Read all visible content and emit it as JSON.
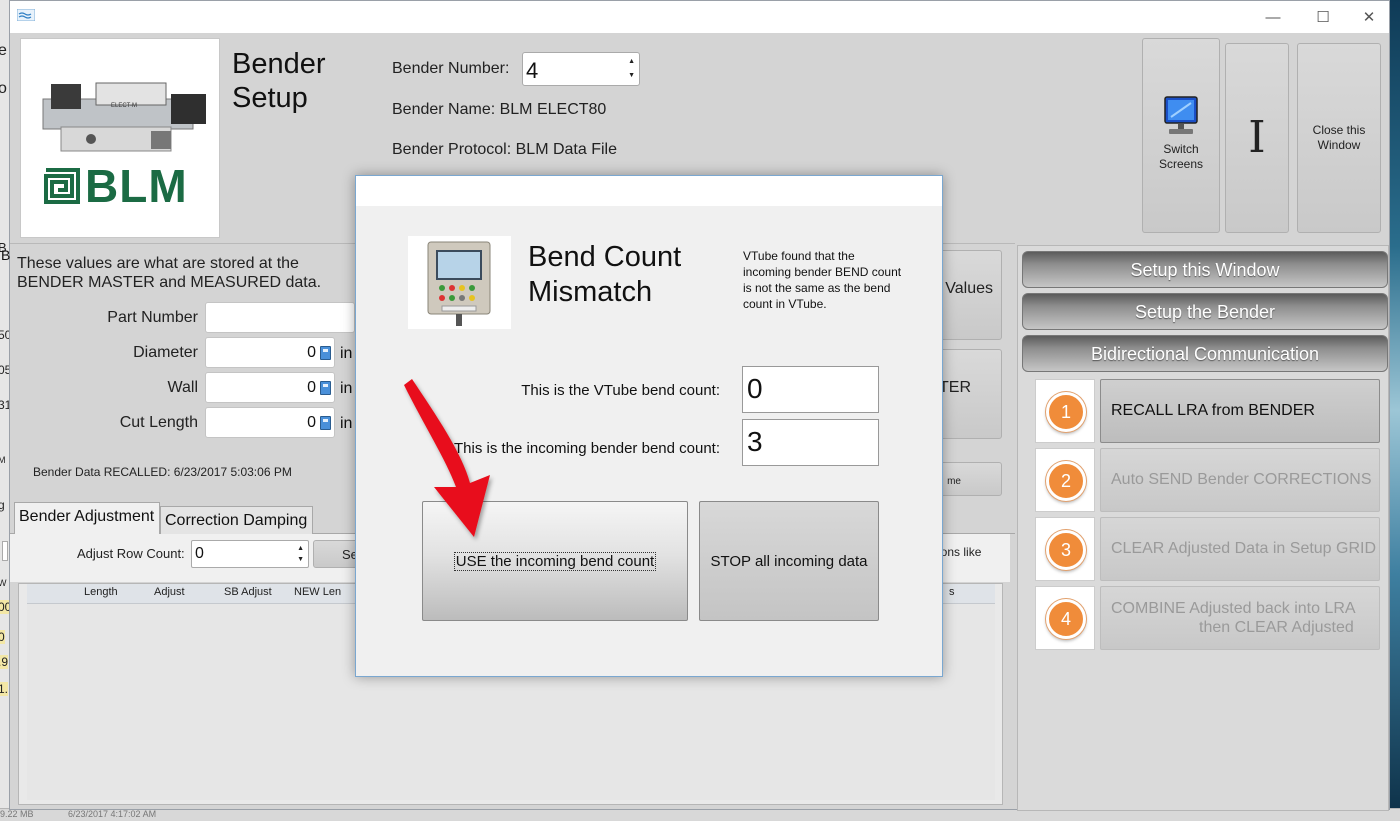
{
  "background_fragments": {
    "left": [
      "e",
      "o",
      "B",
      "50",
      "05",
      "31",
      "M",
      "g",
      "00",
      "W",
      "0",
      ".9",
      "1."
    ],
    "status_bar": [
      "9.22 MB",
      "6/23/2017 4:17:02 AM"
    ]
  },
  "window_controls": {
    "minimize": "—",
    "maximize": "☐",
    "close": "✕"
  },
  "header": {
    "title": "Bender Setup",
    "logo_text": "BLM",
    "machine_label": "ELECT-M",
    "bender_number_label": "Bender Number:",
    "bender_number_value": "4",
    "bender_name": "Bender Name: BLM ELECT80",
    "bender_protocol": "Bender Protocol: BLM Data File",
    "switch_screens": "Switch Screens",
    "cursor_glyph": "I",
    "close_window": "Close this Window"
  },
  "left_panel": {
    "description": "These values are what are stored at the BENDER MASTER and MEASURED data.",
    "part_number_label": "Part Number",
    "part_number_value": "",
    "diameter_label": "Diameter",
    "diameter_value": "0",
    "wall_label": "Wall",
    "wall_value": "0",
    "cut_length_label": "Cut Length",
    "cut_length_value": "0",
    "unit_fragment": "in",
    "recalled_text": "Bender Data RECALLED:  6/23/2017 5:03:06 PM",
    "values_button": "Values",
    "master_button_fragment": "TER",
    "small_button_fragment": "me",
    "variations_fragment": "ations like",
    "tabs": [
      "Bender Adjustment",
      "Correction Damping"
    ],
    "adjust_row_count_label": "Adjust Row Count:",
    "adjust_row_count_value": "0",
    "set_button_fragment": "Se",
    "grid_columns": [
      "Length",
      "Adjust",
      "SB Adjust",
      "NEW Len"
    ],
    "grid_column_fragment": "s",
    "left_edge_fragment": "B"
  },
  "right_panel": {
    "headers": [
      "Setup this Window",
      "Setup the Bender",
      "Bidirectional Communication"
    ],
    "steps": [
      {
        "number": "1",
        "label": "RECALL LRA from BENDER",
        "enabled": true
      },
      {
        "number": "2",
        "label": "Auto SEND Bender CORRECTIONS",
        "enabled": false
      },
      {
        "number": "3",
        "label": "CLEAR Adjusted Data in Setup GRID",
        "enabled": false
      },
      {
        "number": "4",
        "label_line1": "COMBINE Adjusted back into LRA",
        "label_line2": "then CLEAR Adjusted",
        "enabled": false
      }
    ]
  },
  "modal": {
    "title": "Bend Count Mismatch",
    "message": "VTube found that the incoming bender BEND count is not the same as the bend count in VTube.",
    "vtube_label": "This is the VTube bend count:",
    "vtube_value": "0",
    "incoming_label": "This is the incoming bender bend count:",
    "incoming_value": "3",
    "use_button": "USE the incoming bend count",
    "stop_button": "STOP all incoming data"
  },
  "colors": {
    "arrow": "#e8111a",
    "step_circle": "#f08c3a",
    "blm_green": "#1b6b44",
    "modal_border": "#7aa7d0"
  }
}
